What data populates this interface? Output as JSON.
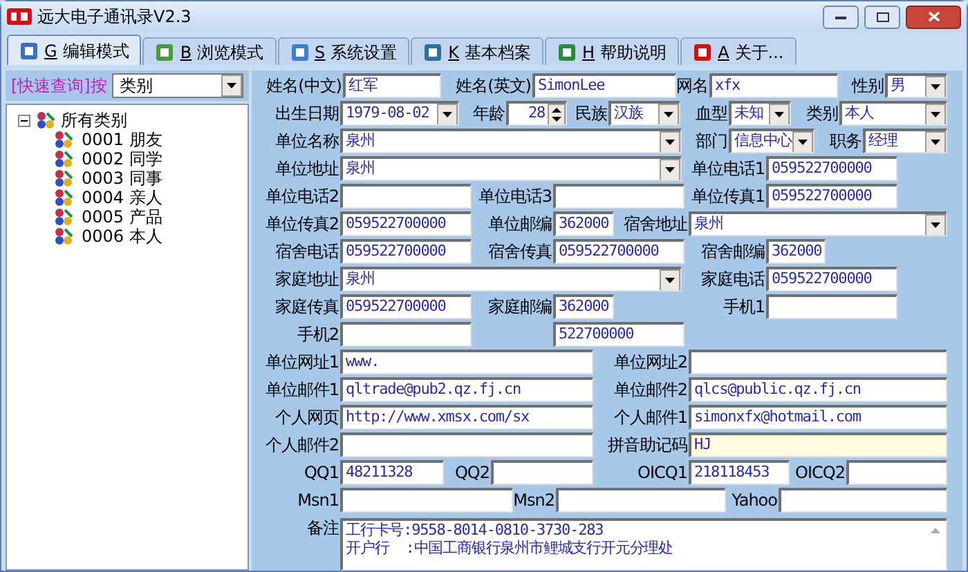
{
  "window": {
    "title": "远大电子通讯录V2.3"
  },
  "tabs": [
    {
      "key": "G",
      "label": "编辑模式",
      "selected": true
    },
    {
      "key": "B",
      "label": "浏览模式",
      "selected": false
    },
    {
      "key": "S",
      "label": "系统设置",
      "selected": false
    },
    {
      "key": "K",
      "label": "基本档案",
      "selected": false
    },
    {
      "key": "H",
      "label": "帮助说明",
      "selected": false
    },
    {
      "key": "A",
      "label": "关于...",
      "selected": false
    }
  ],
  "sidebar": {
    "query_label": "[快速查询]按",
    "query_field": "类别",
    "tree": [
      {
        "label": "所有类别",
        "expanded": true,
        "children": [
          {
            "label": "0001 朋友"
          },
          {
            "label": "0002 同学"
          },
          {
            "label": "0003 同事"
          },
          {
            "label": "0004 亲人"
          },
          {
            "label": "0005 产品"
          },
          {
            "label": "0006 本人"
          }
        ]
      }
    ]
  },
  "form": {
    "rows": [
      {
        "items": [
          {
            "label": "姓名(中文)",
            "kind": "text",
            "value": "红军"
          },
          {
            "label": "姓名(英文)",
            "kind": "text",
            "value": "SimonLee"
          },
          {
            "label": "网名",
            "kind": "text",
            "value": "xfx"
          },
          {
            "label": "性别",
            "kind": "combo",
            "value": "男"
          }
        ]
      },
      {
        "items": [
          {
            "label": "出生日期",
            "kind": "combo",
            "value": "1979-08-02"
          },
          {
            "label": "年龄",
            "kind": "spin",
            "value": "28"
          },
          {
            "label": "民族",
            "kind": "combo",
            "value": "汉族"
          },
          {
            "label": "血型",
            "kind": "combo",
            "value": "未知"
          },
          {
            "label": "类别",
            "kind": "combo",
            "value": "本人"
          }
        ]
      },
      {
        "items": [
          {
            "label": "单位名称",
            "kind": "combo",
            "value": "泉州"
          },
          {
            "label": "部门",
            "kind": "combo",
            "value": "信息中心"
          },
          {
            "label": "职务",
            "kind": "combo",
            "value": "经理"
          }
        ]
      },
      {
        "items": [
          {
            "label": "单位地址",
            "kind": "combo",
            "value": "泉州"
          },
          {
            "label": "单位电话1",
            "kind": "text",
            "value": "059522700000"
          }
        ]
      },
      {
        "items": [
          {
            "label": "单位电话2",
            "kind": "text"
          },
          {
            "label": "单位电话3",
            "kind": "text"
          },
          {
            "label": "单位传真1",
            "kind": "text",
            "value": "059522700000"
          }
        ]
      },
      {
        "items": [
          {
            "label": "单位传真2",
            "kind": "text",
            "value": "059522700000"
          },
          {
            "label": "单位邮编",
            "kind": "text",
            "value": "362000"
          },
          {
            "label": "宿舍地址",
            "kind": "combo",
            "value": "泉州"
          }
        ]
      },
      {
        "items": [
          {
            "label": "宿舍电话",
            "kind": "text",
            "value": "059522700000"
          },
          {
            "label": "宿舍传真",
            "kind": "text",
            "value": "059522700000"
          },
          {
            "label": "宿舍邮编",
            "kind": "text",
            "value": "362000"
          }
        ]
      },
      {
        "items": [
          {
            "label": "家庭地址",
            "kind": "combo",
            "value": "泉州"
          },
          {
            "label": "家庭电话",
            "kind": "text",
            "value": "059522700000"
          }
        ]
      },
      {
        "items": [
          {
            "label": "家庭传真",
            "kind": "text",
            "value": "059522700000"
          },
          {
            "label": "家庭邮编",
            "kind": "text",
            "value": "362000"
          },
          {
            "label": "手机1",
            "kind": "text"
          }
        ]
      },
      {
        "items": [
          {
            "label": "手机2",
            "kind": "text"
          },
          {
            "kind": "text",
            "value": "522700000"
          }
        ]
      },
      {
        "items": [
          {
            "label": "单位网址1",
            "kind": "text",
            "value": "www."
          },
          {
            "label": "单位网址2",
            "kind": "text"
          }
        ]
      },
      {
        "items": [
          {
            "label": "单位邮件1",
            "kind": "text",
            "value": "qltrade@pub2.qz.fj.cn"
          },
          {
            "label": "单位邮件2",
            "kind": "text",
            "value": "qlcs@public.qz.fj.cn"
          }
        ]
      },
      {
        "items": [
          {
            "label": "个人网页",
            "kind": "text",
            "value": "http://www.xmsx.com/sx"
          },
          {
            "label": "个人邮件1",
            "kind": "text",
            "value": "simonxfx@hotmail.com"
          }
        ]
      },
      {
        "items": [
          {
            "label": "个人邮件2",
            "kind": "text"
          },
          {
            "label": "拼音助记码",
            "kind": "text",
            "value": "HJ",
            "highlighted": true
          }
        ]
      },
      {
        "items": [
          {
            "label": "QQ1",
            "kind": "text",
            "value": "48211328"
          },
          {
            "label": "QQ2",
            "kind": "text"
          },
          {
            "label": "OICQ1",
            "kind": "text",
            "value": "218118453"
          },
          {
            "label": "OICQ2",
            "kind": "text"
          }
        ]
      },
      {
        "items": [
          {
            "label": "Msn1",
            "kind": "text"
          },
          {
            "label": "Msn2",
            "kind": "text"
          },
          {
            "label": "Yahoo",
            "kind": "text"
          }
        ]
      },
      {
        "items": [
          {
            "label": "备注",
            "kind": "memo",
            "lines": [
              "工行卡号:9558-8014-0810-3730-283",
              "开户行  :中国工商银行泉州市鲤城支行开元分理处"
            ]
          }
        ]
      }
    ]
  }
}
